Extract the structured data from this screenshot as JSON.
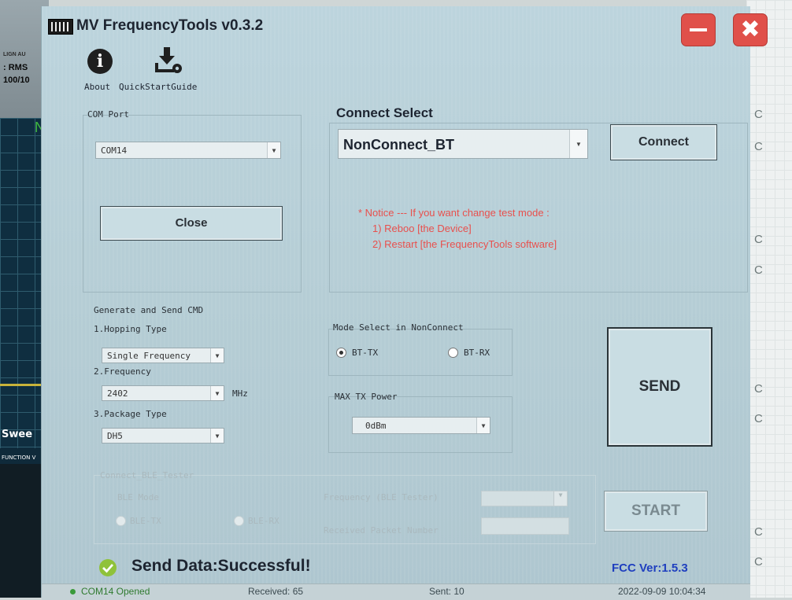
{
  "background": {
    "instrument_labels": [
      "LIGN AU",
      ": RMS",
      "100/10"
    ],
    "marker_letter": "N",
    "sweep_label": "Swee",
    "function_label": "FUNCTION V",
    "right_column_char": "C"
  },
  "window": {
    "title": "MV FrequencyTools v0.3.2",
    "minimize_icon": "minimize-icon",
    "close_icon": "close-icon",
    "close_glyph": "✖"
  },
  "toolbar": {
    "about_label": "About",
    "about_glyph": "i",
    "quickstart_label": "QuickStartGuide"
  },
  "com_port": {
    "group_label": "COM Port",
    "selected": "COM14",
    "close_button": "Close"
  },
  "connect_select": {
    "label": "Connect Select",
    "selected": "NonConnect_BT",
    "connect_button": "Connect",
    "notice_lines": [
      "* Notice --- If you want change test mode :",
      "1) Reboo [the Device]",
      "2) Restart [the FrequencyTools software]"
    ]
  },
  "generate": {
    "group_label": "Generate and Send CMD",
    "hopping_label": "1.Hopping Type",
    "hopping_value": "Single Frequency",
    "frequency_label": "2.Frequency",
    "frequency_value": "2402",
    "frequency_unit": "MHz",
    "package_label": "3.Package Type",
    "package_value": "DH5",
    "mode_group_label": "Mode Select in NonConnect",
    "mode_tx": "BT-TX",
    "mode_rx": "BT-RX",
    "mode_selected": "BT-TX",
    "max_power_label": "MAX TX Power",
    "max_power_value": "0dBm",
    "send_button": "SEND"
  },
  "ble": {
    "group_label": "Connect_BLE_Tester",
    "mode_label": "BLE Mode",
    "ble_tx": "BLE-TX",
    "ble_rx": "BLE-RX",
    "frequency_label": "Frequency (BLE Tester)",
    "received_label": "Received Packet Number",
    "start_button": "START"
  },
  "result": {
    "message": "Send Data:Successful!",
    "fcc_version": "FCC Ver:1.5.3"
  },
  "statusbar": {
    "port_status": "COM14 Opened",
    "received": "Received: 65",
    "sent": "Sent: 10",
    "datetime": "2022-09-09 10:04:34"
  },
  "colors": {
    "notice": "#e8504d",
    "fcc": "#1f3fbf",
    "success_icon": "#8fc23a",
    "title_buttons": "#e0504a"
  }
}
